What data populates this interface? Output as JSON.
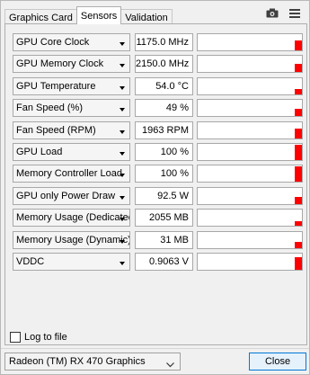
{
  "tabs": [
    {
      "label": "Graphics Card"
    },
    {
      "label": "Sensors"
    },
    {
      "label": "Validation"
    }
  ],
  "active_tab": "Sensors",
  "toolbar": {
    "icons": [
      "camera-icon",
      "menu-icon"
    ]
  },
  "sensors": [
    {
      "name": "GPU Core Clock",
      "value": "1175.0 MHz",
      "level": 0.6
    },
    {
      "name": "GPU Memory Clock",
      "value": "2150.0 MHz",
      "level": 0.5
    },
    {
      "name": "GPU Temperature",
      "value": "54.0 °C",
      "level": 0.35
    },
    {
      "name": "Fan Speed (%)",
      "value": "49 %",
      "level": 0.45
    },
    {
      "name": "Fan Speed (RPM)",
      "value": "1963 RPM",
      "level": 0.6
    },
    {
      "name": "GPU Load",
      "value": "100 %",
      "level": 0.95
    },
    {
      "name": "Memory Controller Load",
      "value": "100 %",
      "level": 0.95
    },
    {
      "name": "GPU only Power Draw",
      "value": "92.5 W",
      "level": 0.45
    },
    {
      "name": "Memory Usage (Dedicated)",
      "value": "2055 MB",
      "level": 0.25
    },
    {
      "name": "Memory Usage (Dynamic)",
      "value": "31 MB",
      "level": 0.4
    },
    {
      "name": "VDDC",
      "value": "0.9063 V",
      "level": 0.75
    }
  ],
  "log_to_file": {
    "label": "Log to file",
    "checked": false
  },
  "gpu_select": {
    "value": "Radeon (TM) RX 470 Graphics"
  },
  "close_button": {
    "label": "Close"
  },
  "colors": {
    "graph_bar": "#ff0000",
    "accent": "#0078d7"
  }
}
